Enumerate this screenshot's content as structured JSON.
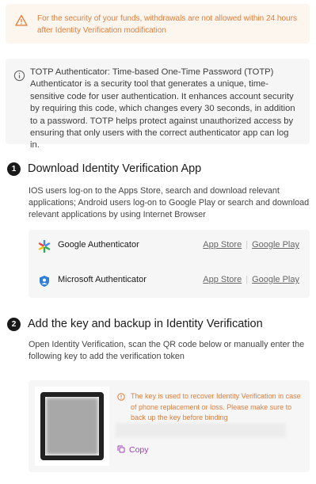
{
  "warning": {
    "icon": "warning-triangle-icon",
    "text": "For the security of your funds, withdrawals are not allowed within 24 hours after Identity Verification modification"
  },
  "info": {
    "icon": "info-circle-icon",
    "text": "TOTP Authenticator: Time-based One-Time Password (TOTP) Authenticator is a security tool that generates a unique, time-sensitive code for user authentication. It enhances account security by requiring this code, which changes every 30 seconds, in addition to a password. TOTP helps protect against unauthorized access by ensuring that only users with the correct authenticator app can log in."
  },
  "step1": {
    "number": "1",
    "title": "Download Identity Verification App",
    "description": "IOS users log-on to the Apps Store, search and download relevant applications; Android users log-on to Google Play or search and download relevant applications by using Internet Browser"
  },
  "apps": [
    {
      "name": "Google Authenticator",
      "icon": "google-authenticator-icon",
      "app_store": "App Store",
      "google_play": "Google Play"
    },
    {
      "name": "Microsoft Authenticator",
      "icon": "microsoft-authenticator-icon",
      "app_store": "App Store",
      "google_play": "Google Play"
    }
  ],
  "step2": {
    "number": "2",
    "title": "Add the key and backup in Identity Verification",
    "description": "Open Identity Verification, scan the QR code below or manually enter the following key to add the verification token"
  },
  "key_section": {
    "note_icon": "warning-circle-icon",
    "note": "The key is used to recover Identity Verification in case of phone replacement or loss. Please make sure to back up the key before binding",
    "copy_label": "Copy"
  },
  "colors": {
    "warning": "#e27d39",
    "accent": "#a23cbf",
    "panel": "#f6f6f6"
  }
}
